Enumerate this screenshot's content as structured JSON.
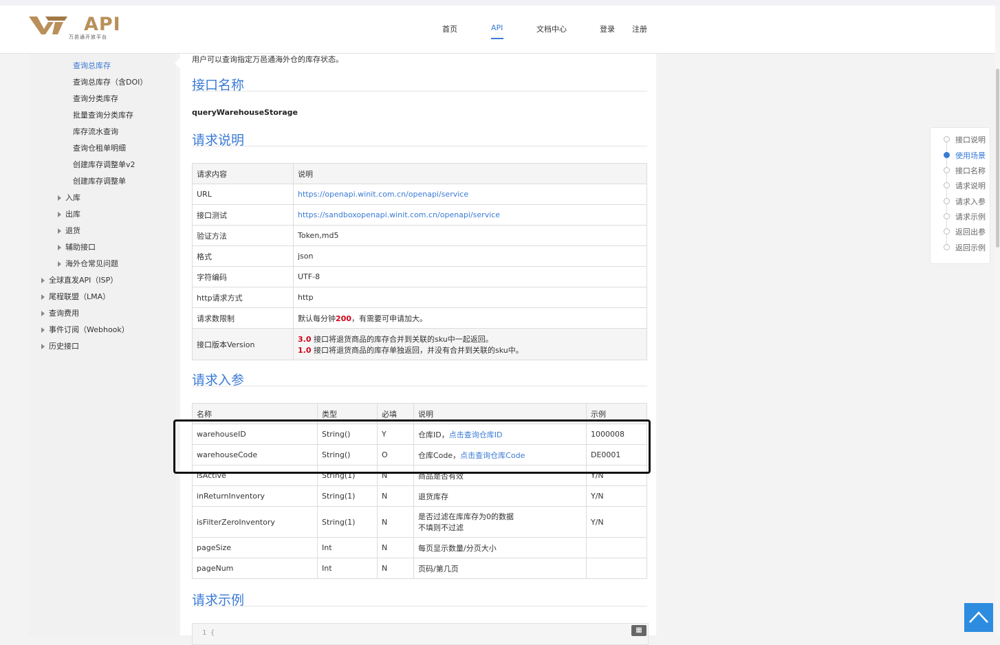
{
  "header": {
    "logo_text": "API",
    "logo_sub": "万邑通开放平台",
    "nav": [
      {
        "label": "首页"
      },
      {
        "label": "API"
      },
      {
        "label": "文档中心"
      },
      {
        "label": "登录"
      },
      {
        "label": "注册"
      }
    ]
  },
  "sidebar": {
    "sub_items": [
      "查询总库存",
      "查询总库存（含DOI）",
      "查询分类库存",
      "批量查询分类库存",
      "库存流水查询",
      "查询仓租单明细",
      "创建库存调整单v2",
      "创建库存调整单"
    ],
    "groups": [
      "入库",
      "出库",
      "退货",
      "辅助接口",
      "海外仓常见问题"
    ],
    "top": [
      "全球直发API（ISP）",
      "尾程联盟（LMA）",
      "查询费用",
      "事件订阅（Webhook）",
      "历史接口"
    ]
  },
  "main": {
    "intro": "用户可以查询指定万邑通海外仓的库存状态。",
    "sections": {
      "api_name_title": "接口名称",
      "api_name": "queryWarehouseStorage",
      "req_desc_title": "请求说明",
      "req_params_title": "请求入参",
      "req_example_title": "请求示例"
    },
    "req_table": {
      "headers": [
        "请求内容",
        "说明"
      ],
      "rows": [
        {
          "k": "URL",
          "v": "https://openapi.winit.com.cn/openapi/service"
        },
        {
          "k": "接口测试",
          "v": "https://sandboxopenapi.winit.com.cn/openapi/service"
        },
        {
          "k": "验证方法",
          "v": "Token,md5"
        },
        {
          "k": "格式",
          "v": "json"
        },
        {
          "k": "字符编码",
          "v": "UTF-8"
        },
        {
          "k": "http请求方式",
          "v": "http"
        },
        {
          "k": "请求数限制",
          "v_pre": "默认每分钟",
          "v_num": "200",
          "v_post": "，有需要可申请加大。"
        },
        {
          "k": "接口版本Version",
          "v1_num": "3.0",
          "v1": " 接口将退货商品的库存合并到关联的sku中一起返回。",
          "v2_num": "1.0",
          "v2": " 接口将退货商品的库存单独返回，并没有合并到关联的sku中。"
        }
      ]
    },
    "param_table": {
      "headers": [
        "名称",
        "类型",
        "必填",
        "说明",
        "示例"
      ],
      "rows": [
        {
          "name": "warehouseID",
          "type": "String()",
          "req": "Y",
          "desc": "仓库ID，",
          "link": "点击查询仓库ID",
          "ex": "1000008"
        },
        {
          "name": "warehouseCode",
          "type": "String()",
          "req": "O",
          "desc": "仓库Code，",
          "link": "点击查询仓库Code",
          "ex": "DE0001"
        },
        {
          "name": "isActive",
          "type": "String(1)",
          "req": "N",
          "desc": "商品是否有效",
          "link": "",
          "ex": "Y/N"
        },
        {
          "name": "inReturnInventory",
          "type": "String(1)",
          "req": "N",
          "desc": "退货库存",
          "link": "",
          "ex": "Y/N"
        },
        {
          "name": "isFilterZeroInventory",
          "type": "String(1)",
          "req": "N",
          "desc": "是否过滤在库库存为0的数据",
          "desc2": "不填则不过滤",
          "link": "",
          "ex": "Y/N"
        },
        {
          "name": "pageSize",
          "type": "Int",
          "req": "N",
          "desc": "每页显示数量/分页大小",
          "link": "",
          "ex": ""
        },
        {
          "name": "pageNum",
          "type": "Int",
          "req": "N",
          "desc": "页码/第几页",
          "link": "",
          "ex": ""
        }
      ]
    },
    "code_first_line": "1  {"
  },
  "toc": {
    "items": [
      "接口说明",
      "使用场景",
      "接口名称",
      "请求说明",
      "请求入参",
      "请求示例",
      "返回出参",
      "返回示例"
    ],
    "active_index": 1
  },
  "colors": {
    "accent": "#3a7ad5",
    "highlight_red": "#d0021b",
    "backtop": "#2d8ce0"
  }
}
